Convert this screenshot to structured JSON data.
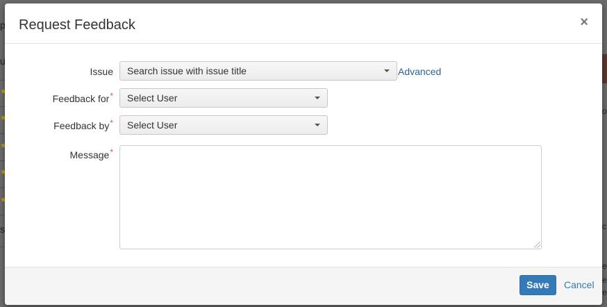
{
  "dialog": {
    "title": "Request Feedback",
    "close_label": "×"
  },
  "form": {
    "issue": {
      "label": "Issue",
      "placeholder": "Search issue with issue title",
      "advanced_label": "Advanced"
    },
    "feedback_for": {
      "label": "Feedback for",
      "required_marker": "*",
      "placeholder": "Select User"
    },
    "feedback_by": {
      "label": "Feedback by",
      "required_marker": "*",
      "placeholder": "Select User"
    },
    "message": {
      "label": "Message",
      "required_marker": "*",
      "value": ""
    }
  },
  "footer": {
    "save_label": "Save",
    "cancel_label": "Cancel"
  },
  "colors": {
    "primary": "#337ab7",
    "link": "#2a6496",
    "required": "#d9534f"
  }
}
